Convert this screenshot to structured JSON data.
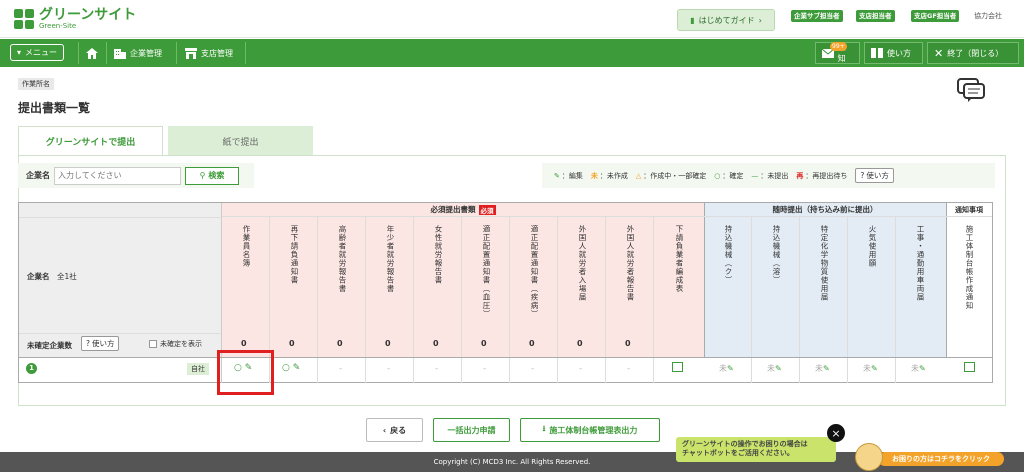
{
  "logo": {
    "jp": "グリーンサイト",
    "en": "Green-Site"
  },
  "guide_button": "はじめてガイド",
  "roles": [
    "企業サブ担当者",
    "支店担当者",
    "支店GF担当者"
  ],
  "partner_label": "協力会社",
  "nav": {
    "menu": "メニュー",
    "company": "企業管理",
    "branch": "支店管理",
    "notice": "通知",
    "notice_count": "99+",
    "howto": "使い方",
    "exit": "終了（閉じる）"
  },
  "breadcrumb": "作業所名",
  "page_title": "提出書類一覧",
  "tabs": [
    {
      "label": "グリーンサイトで提出",
      "active": true
    },
    {
      "label": "紙で提出",
      "active": false
    }
  ],
  "search": {
    "label": "企業名",
    "placeholder": "入力してください",
    "button": "検索"
  },
  "legend": {
    "edit": "：編集",
    "unmade_mark": "未",
    "unmade": "：未作成",
    "partial": "：作成中・一部確定",
    "confirm": "：確定",
    "notsubmit": "：未提出",
    "resubmit_mark": "再",
    "resubmit": "：再提出待ち",
    "howto": "使い方"
  },
  "table": {
    "group_required": "必須提出書類",
    "required_badge": "必須",
    "group_optional": "随時提出（持ち込み前に提出）",
    "group_notice": "通知事項",
    "company_name_label": "企業名",
    "company_count": "全1社",
    "unconfirmed_label": "未確定企業数",
    "howto": "使い方",
    "show_unconfirmed": "未確定を表示",
    "required_cols": [
      "作業員名簿",
      "再下請負通知書",
      "高齢者就労報告書",
      "年少者就労報告書",
      "女性就労報告書",
      "適正配置通知書（血圧）",
      "適正配置通知書（疾病）",
      "外国人就労者入場届",
      "外国人就労者報告書",
      "下請負業者編成表"
    ],
    "required_counts": [
      "0",
      "0",
      "0",
      "0",
      "0",
      "0",
      "0",
      "0",
      "0",
      ""
    ],
    "optional_cols": [
      "持込機械（ク）",
      "持込機械（溶）",
      "特定化学物質使用届",
      "火気使用願",
      "工事・通勤用車両届"
    ],
    "notice_cols": [
      "施工体制台帳作成通知"
    ],
    "row": {
      "number": "1",
      "self_label": "自社",
      "dash": "-",
      "unmade": "未"
    }
  },
  "footer_buttons": {
    "back": "戻る",
    "bulk": "一括出力申請",
    "ledger": "施工体制台帳管理表出力"
  },
  "copyright": "Copyright (C) MCD3 Inc. All Rights Reserved.",
  "chatbot": {
    "line1": "グリーンサイトの操作でお困りの場合は",
    "line2": "チャットボットをご活用ください。",
    "help": "お困りの方はコチラをクリック"
  }
}
